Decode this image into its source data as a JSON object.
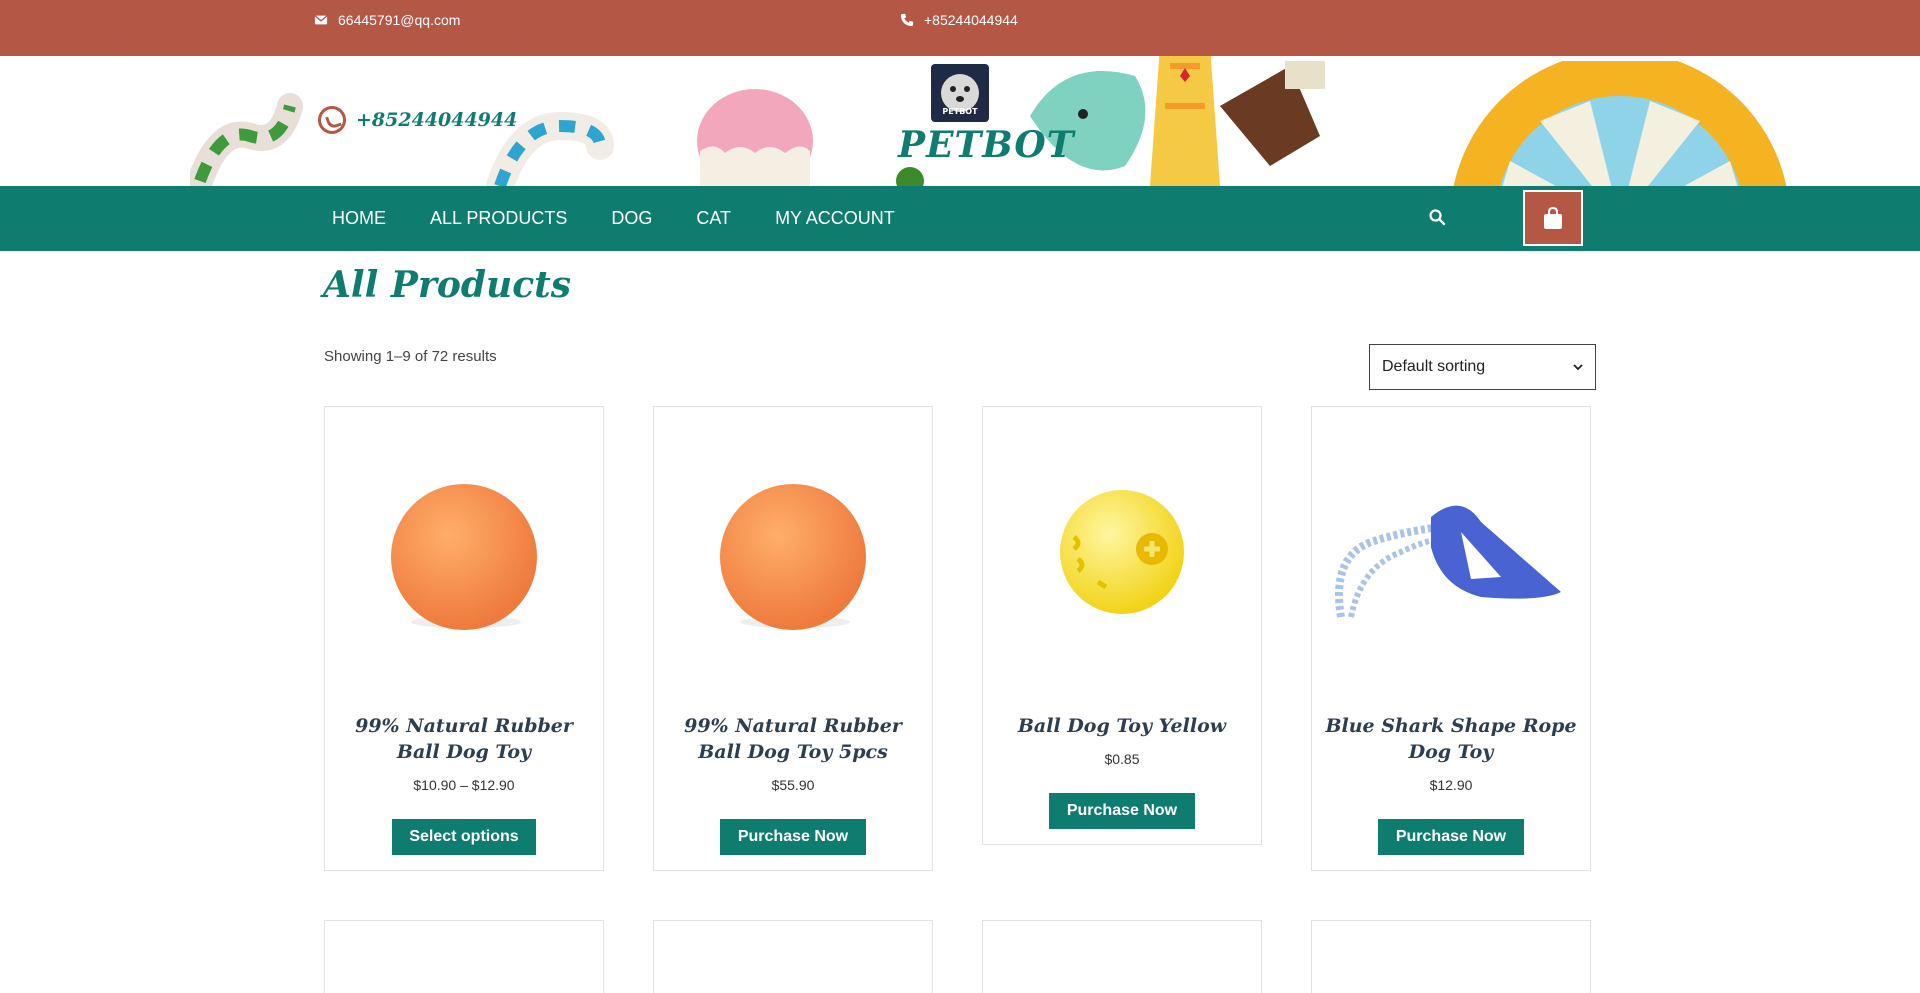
{
  "topbar": {
    "email": "66445791@qq.com",
    "phone": "+85244044944",
    "email_icon": "envelope-icon",
    "phone_icon": "phone-icon",
    "color": "#b55745"
  },
  "header": {
    "whatsapp_phone": "+85244044944",
    "brand": "PETBOT",
    "logo_text": "PETBOT"
  },
  "nav": {
    "items": [
      "HOME",
      "ALL PRODUCTS",
      "DOG",
      "CAT",
      "MY ACCOUNT"
    ],
    "color": "#0f7c70"
  },
  "main": {
    "title": "All Products",
    "result_count": "Showing 1–9 of 72 results",
    "sort_selected": "Default sorting"
  },
  "products": [
    {
      "title": "99% Natural Rubber Ball Dog Toy",
      "price": "$10.90 – $12.90",
      "button": "Select options",
      "image": "orange-ball"
    },
    {
      "title": "99% Natural Rubber Ball Dog Toy 5pcs",
      "price": "$55.90",
      "button": "Purchase Now",
      "image": "orange-ball"
    },
    {
      "title": "Ball Dog Toy Yellow",
      "price": "$0.85",
      "button": "Purchase Now",
      "image": "yellow-ball"
    },
    {
      "title": "Blue Shark Shape Rope Dog Toy",
      "price": "$12.90",
      "button": "Purchase Now",
      "image": "blue-rope-toy"
    }
  ]
}
